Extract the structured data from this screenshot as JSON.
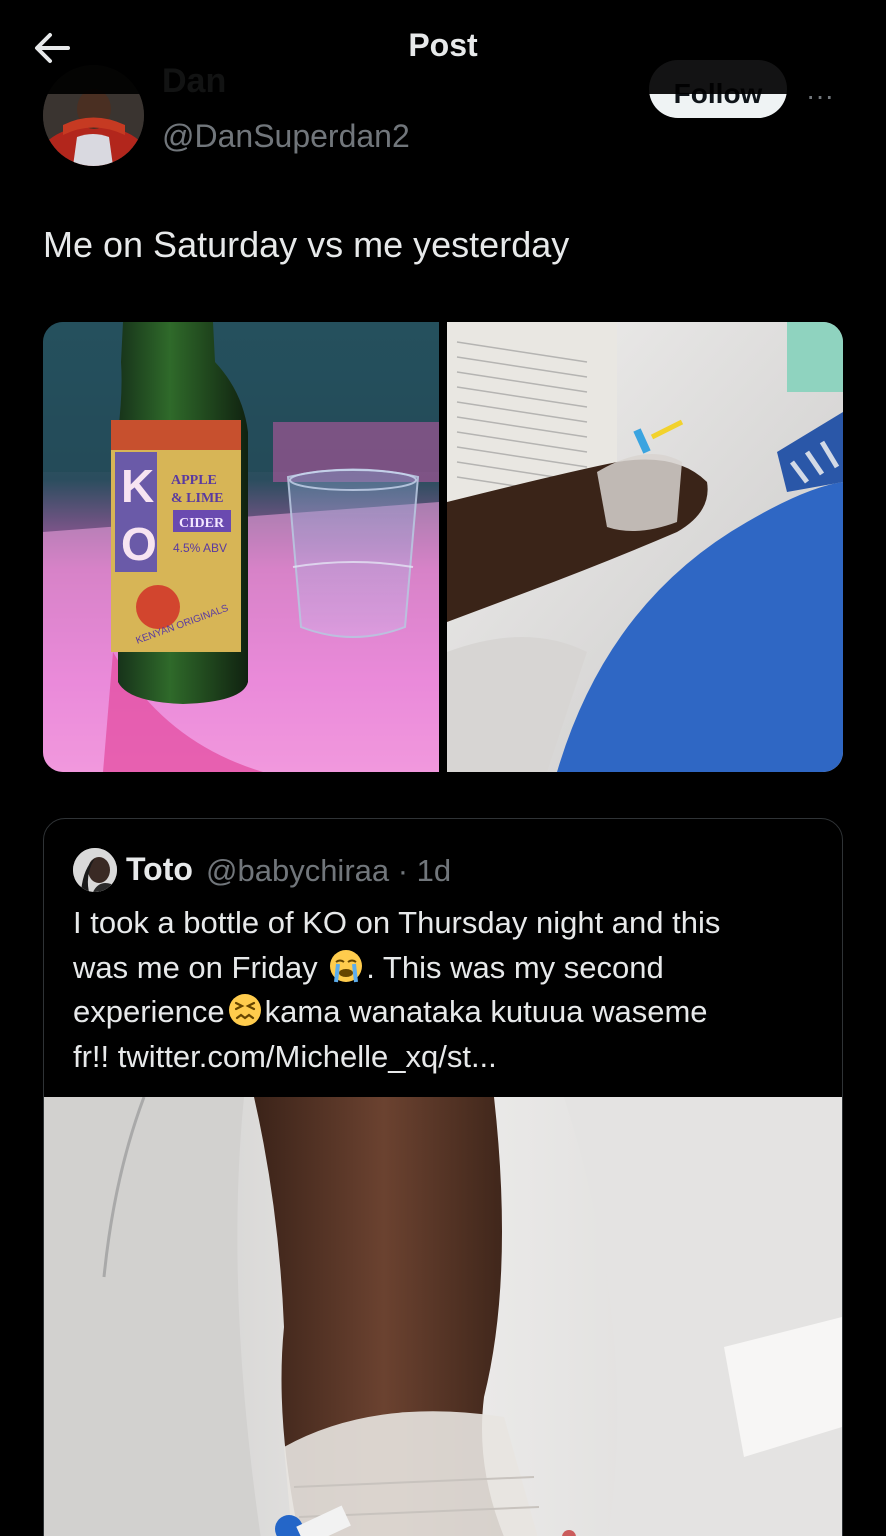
{
  "header": {
    "title": "Post"
  },
  "author": {
    "display_name": "Dan",
    "handle": "@DanSuperdan2",
    "follow_label": "Follow",
    "more_label": "···"
  },
  "post": {
    "text": "Me on Saturday vs me yesterday"
  },
  "media": {
    "bottle_label_letters": "KO",
    "bottle_label_flavor_1": "APPLE",
    "bottle_label_flavor_2": "& LIME",
    "bottle_label_type": "CIDER",
    "bottle_label_abv": "4.5% ABV",
    "bottle_label_brand": "KENYAN ORIGINALS"
  },
  "quote": {
    "display_name": "Toto",
    "handle_and_time": "@babychiraa · 1d",
    "line1": "I took a bottle of KO on Thursday night  and this",
    "line2_a": "was me on Friday ",
    "line2_b": ". This was my second",
    "line3_a": "experience",
    "line3_b": "kama wanataka kutuua waseme",
    "line4": "fr!! twitter.com/Michelle_xq/st..."
  }
}
